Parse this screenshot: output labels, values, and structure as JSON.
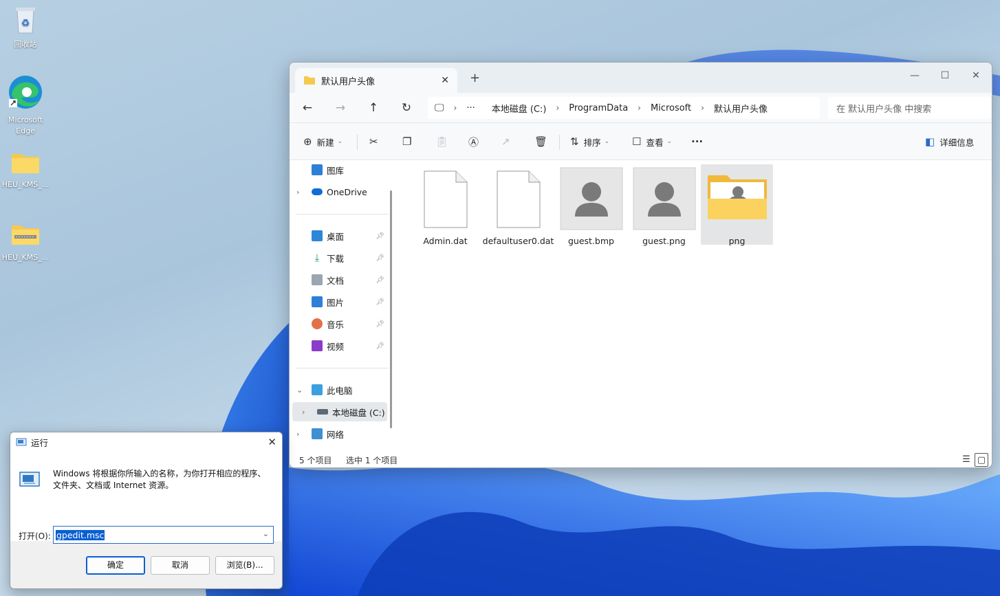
{
  "desktop": {
    "icons": [
      {
        "label": "回收站"
      },
      {
        "label": "Microsoft Edge"
      },
      {
        "label": "HEU_KMS_..."
      },
      {
        "label": "HEU_KMS_..."
      }
    ]
  },
  "explorer": {
    "tab_title": "默认用户头像",
    "breadcrumb": [
      "本地磁盘 (C:)",
      "ProgramData",
      "Microsoft",
      "默认用户头像"
    ],
    "search_placeholder": "在 默认用户头像 中搜索",
    "toolbar": {
      "new": "新建",
      "sort": "排序",
      "view": "查看",
      "details": "详细信息"
    },
    "sidebar": {
      "top": [
        "图库",
        "OneDrive"
      ],
      "quick_access": [
        "桌面",
        "下载",
        "文档",
        "图片",
        "音乐",
        "视频"
      ],
      "this_pc": "此电脑",
      "local_disk": "本地磁盘 (C:)",
      "network": "网络"
    },
    "files": [
      {
        "name": "Admin.dat",
        "type": "file"
      },
      {
        "name": "defaultuser0.dat",
        "type": "file"
      },
      {
        "name": "guest.bmp",
        "type": "image"
      },
      {
        "name": "guest.png",
        "type": "image"
      },
      {
        "name": "png",
        "type": "folder",
        "selected": true
      }
    ],
    "status": {
      "count": "5 个项目",
      "selected": "选中 1 个项目"
    }
  },
  "run_dialog": {
    "title": "运行",
    "description": "Windows 将根据你所输入的名称，为你打开相应的程序、文件夹、文档或 Internet 资源。",
    "open_label": "打开(O):",
    "input_value": "gpedit.msc",
    "buttons": {
      "ok": "确定",
      "cancel": "取消",
      "browse": "浏览(B)..."
    }
  },
  "colors": {
    "accent": "#0a5fd3",
    "folder": "#f6c94e",
    "wallpaper_blue": "#1c5fe8"
  }
}
